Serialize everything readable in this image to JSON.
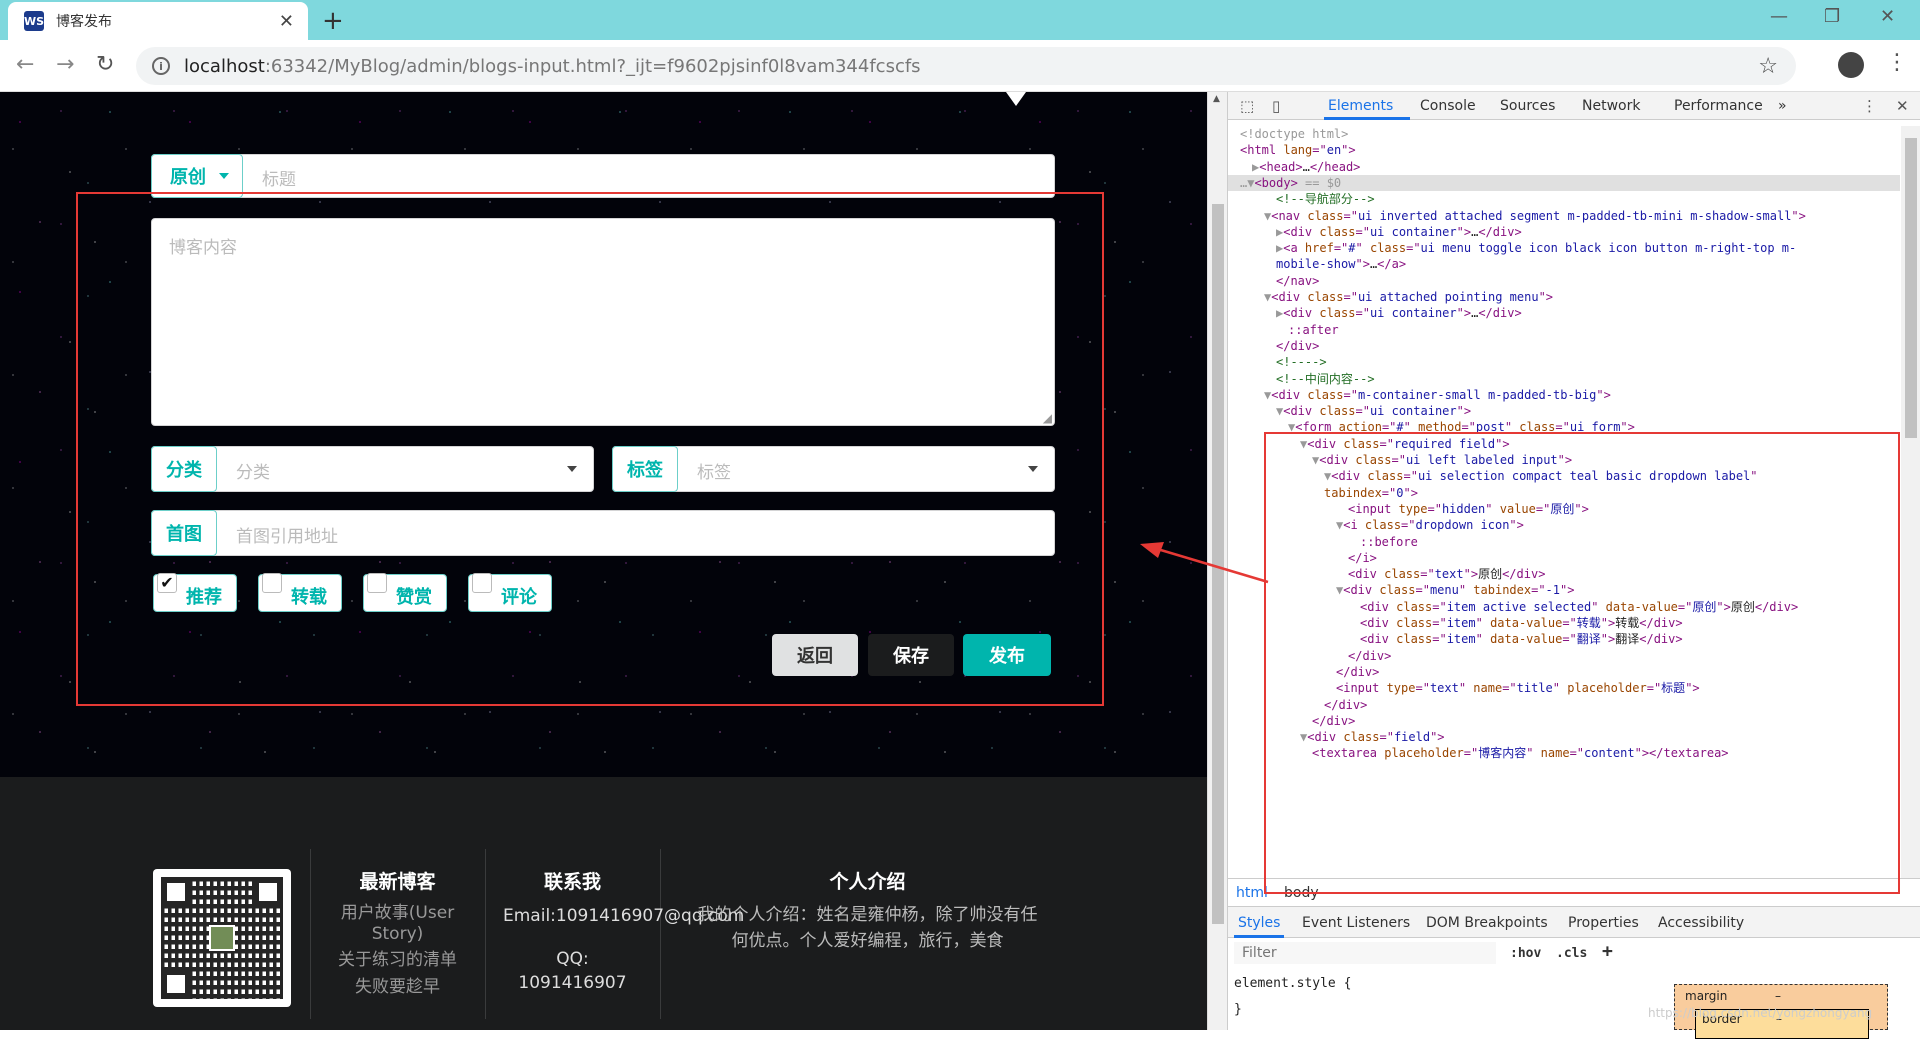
{
  "browser": {
    "tab_title": "博客发布",
    "url_host": "localhost",
    "url_path": ":63342/MyBlog/admin/blogs-input.html?_ijt=f9602pjsinf0l8vam344fcscfs"
  },
  "form": {
    "type_label": "原创",
    "title_placeholder": "标题",
    "content_placeholder": "博客内容",
    "category_label": "分类",
    "category_placeholder": "分类",
    "tag_label": "标签",
    "tag_placeholder": "标签",
    "cover_label": "首图",
    "cover_placeholder": "首图引用地址",
    "checkboxes": [
      {
        "label": "推荐",
        "checked": true
      },
      {
        "label": "转载",
        "checked": false
      },
      {
        "label": "赞赏",
        "checked": false
      },
      {
        "label": "评论",
        "checked": false
      }
    ],
    "back_button": "返回",
    "save_button": "保存",
    "publish_button": "发布"
  },
  "footer": {
    "latest_title": "最新博客",
    "latest_items": [
      "用户故事(User",
      "Story)",
      "关于练习的清单",
      "失败要趁早"
    ],
    "contact_title": "联系我",
    "email": "Email:1091416907@qq.com",
    "qq_label": "QQ:",
    "qq_number": "1091416907",
    "intro_title": "个人介绍",
    "intro_line1": "我的个人介绍：姓名是雍仲杨，除了帅没有任",
    "intro_line2": "何优点。个人爱好编程，旅行，美食"
  },
  "devtools": {
    "tabs": [
      "Elements",
      "Console",
      "Sources",
      "Network",
      "Performance",
      "»"
    ],
    "code_lines": [
      {
        "indent": 0,
        "parts": [
          [
            "g",
            "<!doctype html>"
          ]
        ]
      },
      {
        "indent": 0,
        "parts": [
          [
            "t",
            "<html "
          ],
          [
            "a",
            "lang"
          ],
          [
            "t",
            "=\""
          ],
          [
            "v",
            "en"
          ],
          [
            "t",
            "\">"
          ]
        ]
      },
      {
        "indent": 1,
        "parts": [
          [
            "x",
            "▶"
          ],
          [
            "t",
            "<head>"
          ],
          [
            "c",
            "…"
          ],
          [
            "t",
            "</head>"
          ]
        ]
      },
      {
        "indent": 0,
        "parts": [
          [
            "x",
            "…▼"
          ],
          [
            "t",
            "<body>"
          ],
          [
            "g",
            " == $0"
          ]
        ]
      },
      {
        "indent": 3,
        "parts": [
          [
            "m",
            "<!--导航部分-->"
          ]
        ]
      },
      {
        "indent": 2,
        "parts": [
          [
            "x",
            "▼"
          ],
          [
            "t",
            "<nav "
          ],
          [
            "a",
            "class"
          ],
          [
            "t",
            "=\""
          ],
          [
            "v",
            "ui inverted attached segment m-padded-tb-mini m-shadow-small"
          ],
          [
            "t",
            "\">"
          ]
        ]
      },
      {
        "indent": 3,
        "parts": [
          [
            "x",
            "▶"
          ],
          [
            "t",
            "<div "
          ],
          [
            "a",
            "class"
          ],
          [
            "t",
            "=\""
          ],
          [
            "v",
            "ui container"
          ],
          [
            "t",
            "\">"
          ],
          [
            "c",
            "…"
          ],
          [
            "t",
            "</div>"
          ]
        ]
      },
      {
        "indent": 3,
        "parts": [
          [
            "x",
            "▶"
          ],
          [
            "t",
            "<a "
          ],
          [
            "a",
            "href"
          ],
          [
            "t",
            "=\""
          ],
          [
            "v",
            "#"
          ],
          [
            "t",
            "\" "
          ],
          [
            "a",
            "class"
          ],
          [
            "t",
            "=\""
          ],
          [
            "v",
            "ui menu toggle icon black icon button m-right-top m-"
          ],
          [
            "t",
            ""
          ]
        ]
      },
      {
        "indent": 3,
        "parts": [
          [
            "v",
            "mobile-show"
          ],
          [
            "t",
            "\">"
          ],
          [
            "c",
            "…"
          ],
          [
            "t",
            "</a>"
          ]
        ]
      },
      {
        "indent": 3,
        "parts": [
          [
            "t",
            "</nav>"
          ]
        ]
      },
      {
        "indent": 2,
        "parts": [
          [
            "x",
            "▼"
          ],
          [
            "t",
            "<div "
          ],
          [
            "a",
            "class"
          ],
          [
            "t",
            "=\""
          ],
          [
            "v",
            "ui attached pointing menu"
          ],
          [
            "t",
            "\">"
          ]
        ]
      },
      {
        "indent": 3,
        "parts": [
          [
            "x",
            "▶"
          ],
          [
            "t",
            "<div "
          ],
          [
            "a",
            "class"
          ],
          [
            "t",
            "=\""
          ],
          [
            "v",
            "ui container"
          ],
          [
            "t",
            "\">"
          ],
          [
            "c",
            "…"
          ],
          [
            "t",
            "</div>"
          ]
        ]
      },
      {
        "indent": 4,
        "parts": [
          [
            "t",
            "::after"
          ]
        ]
      },
      {
        "indent": 3,
        "parts": [
          [
            "t",
            "</div>"
          ]
        ]
      },
      {
        "indent": 3,
        "parts": [
          [
            "m",
            "<!---->"
          ]
        ]
      },
      {
        "indent": 3,
        "parts": [
          [
            "m",
            "<!--中间内容-->"
          ]
        ]
      },
      {
        "indent": 2,
        "parts": [
          [
            "x",
            "▼"
          ],
          [
            "t",
            "<div "
          ],
          [
            "a",
            "class"
          ],
          [
            "t",
            "=\""
          ],
          [
            "v",
            "m-container-small m-padded-tb-big"
          ],
          [
            "t",
            "\">"
          ]
        ]
      },
      {
        "indent": 3,
        "parts": [
          [
            "x",
            "▼"
          ],
          [
            "t",
            "<div "
          ],
          [
            "a",
            "class"
          ],
          [
            "t",
            "=\""
          ],
          [
            "v",
            "ui container"
          ],
          [
            "t",
            "\">"
          ]
        ]
      },
      {
        "indent": 4,
        "parts": [
          [
            "x",
            "▼"
          ],
          [
            "t",
            "<form "
          ],
          [
            "a",
            "action"
          ],
          [
            "t",
            "=\""
          ],
          [
            "v",
            "#"
          ],
          [
            "t",
            "\" "
          ],
          [
            "a",
            "method"
          ],
          [
            "t",
            "=\""
          ],
          [
            "v",
            "post"
          ],
          [
            "t",
            "\" "
          ],
          [
            "a",
            "class"
          ],
          [
            "t",
            "=\""
          ],
          [
            "v",
            "ui form"
          ],
          [
            "t",
            "\">"
          ]
        ]
      },
      {
        "indent": 5,
        "parts": [
          [
            "x",
            "▼"
          ],
          [
            "t",
            "<div "
          ],
          [
            "a",
            "class"
          ],
          [
            "t",
            "=\""
          ],
          [
            "v",
            "required field"
          ],
          [
            "t",
            "\">"
          ]
        ]
      },
      {
        "indent": 6,
        "parts": [
          [
            "x",
            "▼"
          ],
          [
            "t",
            "<div "
          ],
          [
            "a",
            "class"
          ],
          [
            "t",
            "=\""
          ],
          [
            "v",
            "ui left labeled input"
          ],
          [
            "t",
            "\">"
          ]
        ]
      },
      {
        "indent": 7,
        "parts": [
          [
            "x",
            "▼"
          ],
          [
            "t",
            "<div "
          ],
          [
            "a",
            "class"
          ],
          [
            "t",
            "=\""
          ],
          [
            "v",
            "ui selection compact teal basic dropdown label"
          ],
          [
            "t",
            "\""
          ]
        ]
      },
      {
        "indent": 7,
        "parts": [
          [
            "a",
            "tabindex"
          ],
          [
            "t",
            "=\""
          ],
          [
            "v",
            "0"
          ],
          [
            "t",
            "\">"
          ]
        ]
      },
      {
        "indent": 9,
        "parts": [
          [
            "t",
            "<input "
          ],
          [
            "a",
            "type"
          ],
          [
            "t",
            "=\""
          ],
          [
            "v",
            "hidden"
          ],
          [
            "t",
            "\" "
          ],
          [
            "a",
            "value"
          ],
          [
            "t",
            "=\""
          ],
          [
            "v",
            "原创"
          ],
          [
            "t",
            "\">"
          ]
        ]
      },
      {
        "indent": 8,
        "parts": [
          [
            "x",
            "▼"
          ],
          [
            "t",
            "<i "
          ],
          [
            "a",
            "class"
          ],
          [
            "t",
            "=\""
          ],
          [
            "v",
            "dropdown icon"
          ],
          [
            "t",
            "\">"
          ]
        ]
      },
      {
        "indent": 10,
        "parts": [
          [
            "t",
            "::before"
          ]
        ]
      },
      {
        "indent": 9,
        "parts": [
          [
            "t",
            "</i>"
          ]
        ]
      },
      {
        "indent": 9,
        "parts": [
          [
            "t",
            "<div "
          ],
          [
            "a",
            "class"
          ],
          [
            "t",
            "=\""
          ],
          [
            "v",
            "text"
          ],
          [
            "t",
            "\">"
          ],
          [
            "c",
            "原创"
          ],
          [
            "t",
            "</div>"
          ]
        ]
      },
      {
        "indent": 8,
        "parts": [
          [
            "x",
            "▼"
          ],
          [
            "t",
            "<div "
          ],
          [
            "a",
            "class"
          ],
          [
            "t",
            "=\""
          ],
          [
            "v",
            "menu"
          ],
          [
            "t",
            "\" "
          ],
          [
            "a",
            "tabindex"
          ],
          [
            "t",
            "=\""
          ],
          [
            "v",
            "-1"
          ],
          [
            "t",
            "\">"
          ]
        ]
      },
      {
        "indent": 10,
        "parts": [
          [
            "t",
            "<div "
          ],
          [
            "a",
            "class"
          ],
          [
            "t",
            "=\""
          ],
          [
            "v",
            "item active selected"
          ],
          [
            "t",
            "\" "
          ],
          [
            "a",
            "data-value"
          ],
          [
            "t",
            "=\""
          ],
          [
            "v",
            "原创"
          ],
          [
            "t",
            "\">"
          ],
          [
            "c",
            "原创"
          ],
          [
            "t",
            "</div>"
          ]
        ]
      },
      {
        "indent": 10,
        "parts": [
          [
            "t",
            "<div "
          ],
          [
            "a",
            "class"
          ],
          [
            "t",
            "=\""
          ],
          [
            "v",
            "item"
          ],
          [
            "t",
            "\" "
          ],
          [
            "a",
            "data-value"
          ],
          [
            "t",
            "=\""
          ],
          [
            "v",
            "转载"
          ],
          [
            "t",
            "\">"
          ],
          [
            "c",
            "转载"
          ],
          [
            "t",
            "</div>"
          ]
        ]
      },
      {
        "indent": 10,
        "parts": [
          [
            "t",
            "<div "
          ],
          [
            "a",
            "class"
          ],
          [
            "t",
            "=\""
          ],
          [
            "v",
            "item"
          ],
          [
            "t",
            "\" "
          ],
          [
            "a",
            "data-value"
          ],
          [
            "t",
            "=\""
          ],
          [
            "v",
            "翻译"
          ],
          [
            "t",
            "\">"
          ],
          [
            "c",
            "翻译"
          ],
          [
            "t",
            "</div>"
          ]
        ]
      },
      {
        "indent": 9,
        "parts": [
          [
            "t",
            "</div>"
          ]
        ]
      },
      {
        "indent": 8,
        "parts": [
          [
            "t",
            "</div>"
          ]
        ]
      },
      {
        "indent": 8,
        "parts": [
          [
            "t",
            "<input "
          ],
          [
            "a",
            "type"
          ],
          [
            "t",
            "=\""
          ],
          [
            "v",
            "text"
          ],
          [
            "t",
            "\" "
          ],
          [
            "a",
            "name"
          ],
          [
            "t",
            "=\""
          ],
          [
            "v",
            "title"
          ],
          [
            "t",
            "\" "
          ],
          [
            "a",
            "placeholder"
          ],
          [
            "t",
            "=\""
          ],
          [
            "v",
            "标题"
          ],
          [
            "t",
            "\">"
          ]
        ]
      },
      {
        "indent": 7,
        "parts": [
          [
            "t",
            "</div>"
          ]
        ]
      },
      {
        "indent": 6,
        "parts": [
          [
            "t",
            "</div>"
          ]
        ]
      },
      {
        "indent": 5,
        "parts": [
          [
            "x",
            "▼"
          ],
          [
            "t",
            "<div "
          ],
          [
            "a",
            "class"
          ],
          [
            "t",
            "=\""
          ],
          [
            "v",
            "field"
          ],
          [
            "t",
            "\">"
          ]
        ]
      },
      {
        "indent": 6,
        "parts": [
          [
            "t",
            "<textarea "
          ],
          [
            "a",
            "placeholder"
          ],
          [
            "t",
            "=\""
          ],
          [
            "v",
            "博客内容"
          ],
          [
            "t",
            "\" "
          ],
          [
            "a",
            "name"
          ],
          [
            "t",
            "=\""
          ],
          [
            "v",
            "content"
          ],
          [
            "t",
            "\"></textarea>"
          ]
        ]
      }
    ],
    "breadcrumbs": [
      "html",
      "body"
    ],
    "style_tabs": [
      "Styles",
      "Event Listeners",
      "DOM Breakpoints",
      "Properties",
      "Accessibility"
    ],
    "filter_placeholder": "Filter",
    "hov_label": ":hov",
    "cls_label": ".cls",
    "element_style": "element.style {",
    "element_brace": "}",
    "box_margin_label": "margin",
    "box_border_label": "border",
    "box_dash": "–"
  },
  "watermark": "https://blog.csdn.net/yongzhongyang"
}
